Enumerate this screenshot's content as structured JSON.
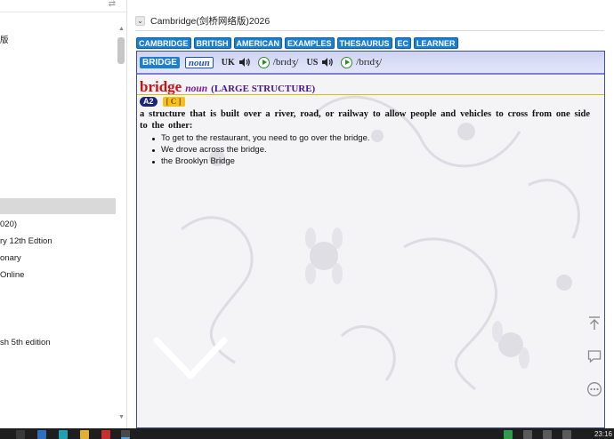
{
  "sidebar": {
    "items": [
      {
        "label": "版"
      },
      {
        "label": "020)"
      },
      {
        "label": "ry 12th Edtion"
      },
      {
        "label": "onary"
      },
      {
        "label": "Online"
      },
      {
        "label": "sh 5th edition"
      }
    ]
  },
  "dictionary": {
    "title": "Cambridge(剑桥网络版)2026",
    "tabs": [
      "CAMBRIDGE",
      "BRITISH",
      "AMERICAN",
      "EXAMPLES",
      "THESAURUS",
      "EC",
      "LEARNER"
    ]
  },
  "entry": {
    "bar_word": "BRIDGE",
    "bar_pos": "noun",
    "uk_label": "UK",
    "us_label": "US",
    "uk_ipa": "/brɪdʒ/",
    "us_ipa": "/brɪdʒ/",
    "headword": "bridge",
    "pos": "noun",
    "guideword": "(LARGE STRUCTURE)",
    "level": "A2",
    "grammar": "[ C ]",
    "definition": "a structure that is built over a river, road, or railway to allow people and vehicles to cross from one side to the other:",
    "examples": [
      "To get to the restaurant, you need to go over the bridge.",
      "We drove across the bridge.",
      "the Brooklyn Bridge"
    ]
  },
  "taskbar": {
    "time": "23:16"
  },
  "colors": {
    "tab_blue": "#1b7fd1",
    "headword_red": "#d01010",
    "level_badge": "#1a237e",
    "grammar_badge": "#f4c21a"
  }
}
